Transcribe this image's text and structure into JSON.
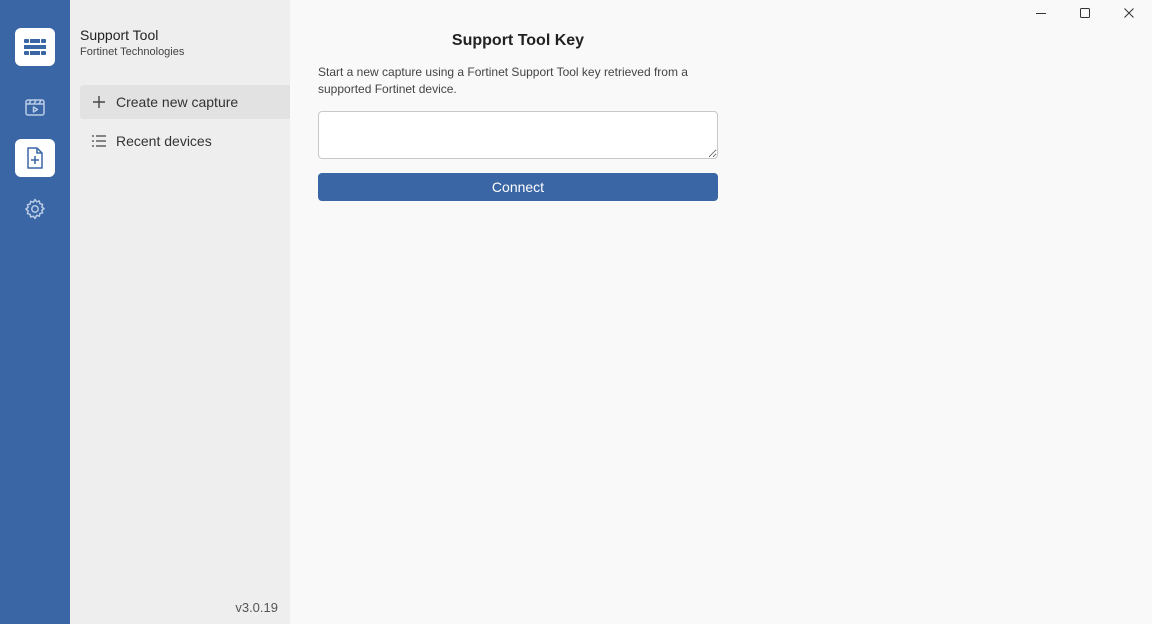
{
  "window": {
    "controls": [
      "minimize-icon",
      "maximize-icon",
      "close-icon"
    ]
  },
  "rail": {
    "items": [
      {
        "name": "logo",
        "icon": "fortinet-logo-icon"
      },
      {
        "name": "captures",
        "icon": "video-play-icon"
      },
      {
        "name": "new-capture",
        "icon": "file-add-icon",
        "active": true
      },
      {
        "name": "settings",
        "icon": "gear-icon"
      }
    ]
  },
  "sidebar": {
    "title": "Support Tool",
    "subtitle": "Fortinet Technologies",
    "items": [
      {
        "label": "Create new capture",
        "icon": "plus-icon",
        "selected": true
      },
      {
        "label": "Recent devices",
        "icon": "list-icon",
        "selected": false
      }
    ],
    "version": "v3.0.19"
  },
  "main": {
    "title": "Support Tool Key",
    "description": "Start a new capture using a Fortinet Support Tool key retrieved from a supported Fortinet device.",
    "key_input": {
      "value": "",
      "placeholder": ""
    },
    "connect_label": "Connect"
  },
  "colors": {
    "rail": "#3a66a5",
    "sidebar": "#eeeeee",
    "main_bg": "#f9f9f9",
    "accent": "#3a66a5"
  }
}
